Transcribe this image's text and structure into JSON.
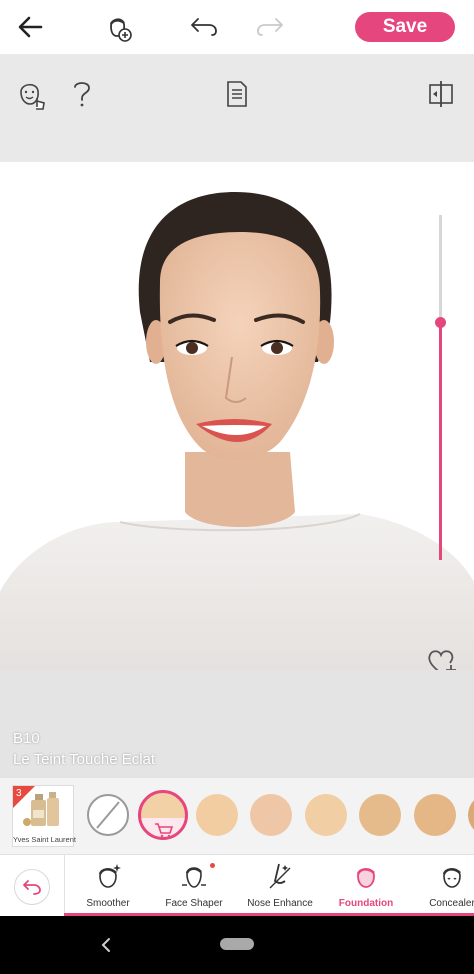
{
  "toolbar": {
    "save_label": "Save",
    "icons": [
      "back-arrow-icon",
      "add-face-icon",
      "undo-icon",
      "redo-icon"
    ]
  },
  "tools": {
    "icons": [
      "face-detect-icon",
      "help-icon",
      "document-icon",
      "compare-icon"
    ]
  },
  "slider": {
    "level": 0.69
  },
  "product": {
    "code": "B10",
    "name": "Le Teint Touche Eclat",
    "brand": "Yves Saint Laurent",
    "brand_count": "3"
  },
  "swatches": {
    "colors": [
      "#f2d1a7",
      "#f1cda1",
      "#efc6a6",
      "#f1cea3",
      "#e6bb8c",
      "#e5b686",
      "#d9a977"
    ]
  },
  "tabs": [
    {
      "label": "Smoother"
    },
    {
      "label": "Face Shaper"
    },
    {
      "label": "Nose Enhance"
    },
    {
      "label": "Foundation"
    },
    {
      "label": "Concealer"
    }
  ],
  "colors": {
    "accent": "#e6467e",
    "badge_red": "#e84a3f"
  }
}
